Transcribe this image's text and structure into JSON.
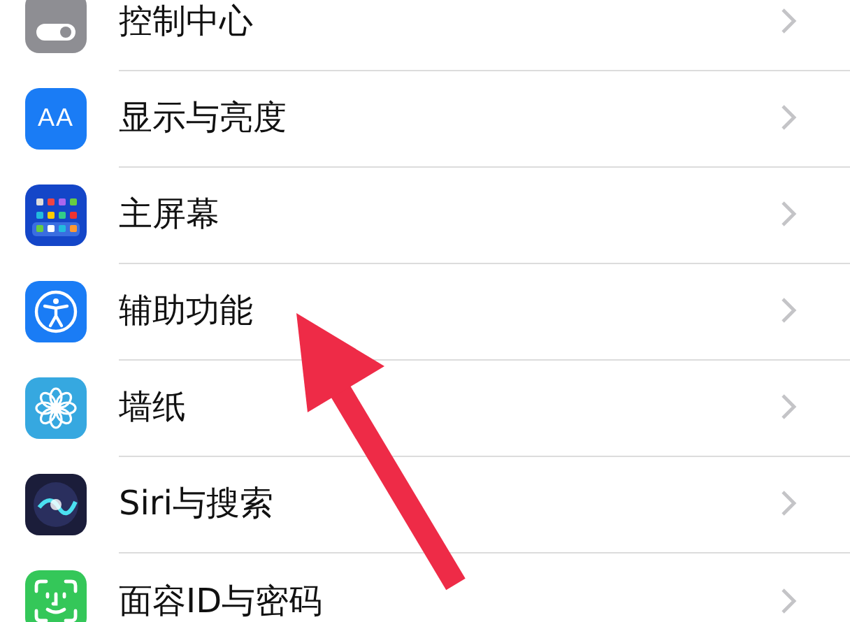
{
  "settings_rows": [
    {
      "kind": "control",
      "label": "控制中心"
    },
    {
      "kind": "display",
      "label": "显示与亮度",
      "icon_text": "AA"
    },
    {
      "kind": "home",
      "label": "主屏幕"
    },
    {
      "kind": "accessibility",
      "label": "辅助功能"
    },
    {
      "kind": "wallpaper",
      "label": "墙纸"
    },
    {
      "kind": "siri",
      "label": "Siri与搜索"
    },
    {
      "kind": "faceid",
      "label": "面容ID与密码"
    }
  ]
}
